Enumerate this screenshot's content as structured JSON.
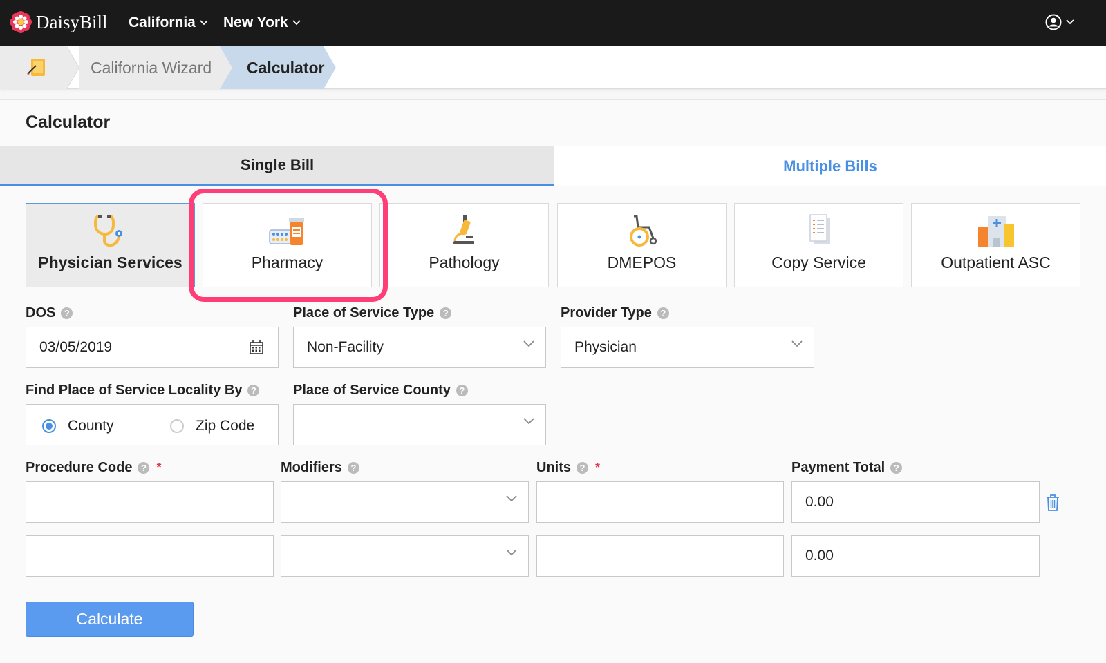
{
  "app": {
    "brand": "DaisyBill"
  },
  "nav": {
    "menus": [
      {
        "label": "California"
      },
      {
        "label": "New York"
      }
    ]
  },
  "breadcrumb": {
    "items": [
      {
        "label": "California Wizard"
      },
      {
        "label": "Calculator"
      }
    ]
  },
  "page": {
    "title": "Calculator"
  },
  "tabs": [
    {
      "label": "Single Bill",
      "active": true
    },
    {
      "label": "Multiple Bills",
      "active": false
    }
  ],
  "service_types": [
    {
      "label": "Physician Services",
      "icon": "stethoscope-icon",
      "active": true
    },
    {
      "label": "Pharmacy",
      "icon": "pill-bottle-icon",
      "active": false
    },
    {
      "label": "Pathology",
      "icon": "microscope-icon",
      "active": false
    },
    {
      "label": "DMEPOS",
      "icon": "wheelchair-icon",
      "active": false
    },
    {
      "label": "Copy Service",
      "icon": "document-copy-icon",
      "active": false
    },
    {
      "label": "Outpatient ASC",
      "icon": "hospital-building-icon",
      "active": false
    }
  ],
  "form": {
    "dos": {
      "label": "DOS",
      "value": "03/05/2019"
    },
    "place_of_service_type": {
      "label": "Place of Service Type",
      "value": "Non-Facility"
    },
    "provider_type": {
      "label": "Provider Type",
      "value": "Physician"
    },
    "locality_by": {
      "label": "Find Place of Service Locality By",
      "options": [
        "County",
        "Zip Code"
      ],
      "selected": "County"
    },
    "county": {
      "label": "Place of Service County",
      "value": ""
    },
    "columns": {
      "procedure_code": "Procedure Code",
      "modifiers": "Modifiers",
      "units": "Units",
      "payment_total": "Payment Total"
    },
    "required_mark": "*",
    "rows": [
      {
        "procedure_code": "",
        "modifiers": "",
        "units": "",
        "payment_total": "0.00"
      },
      {
        "procedure_code": "",
        "modifiers": "",
        "units": "",
        "payment_total": "0.00"
      }
    ],
    "submit_label": "Calculate"
  },
  "colors": {
    "accent": "#4a90e2",
    "button": "#5a9aef",
    "highlight": "#ff3d77",
    "nav_bg": "#1a1a1a",
    "required": "#e0314b"
  }
}
